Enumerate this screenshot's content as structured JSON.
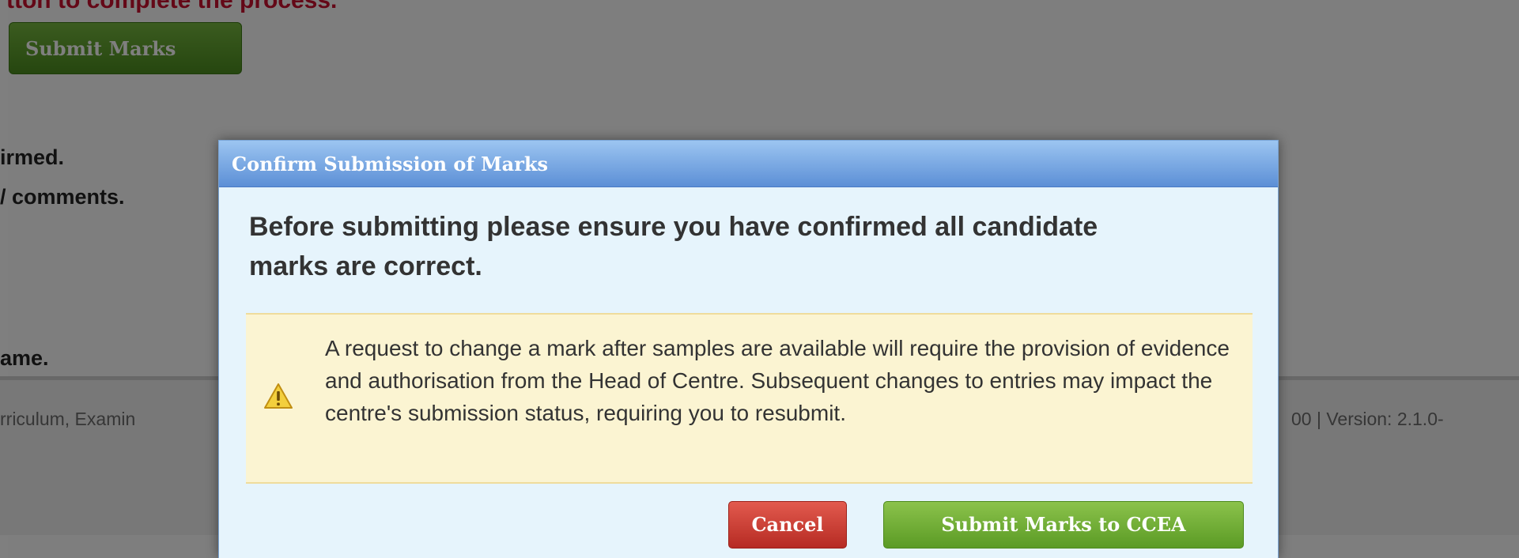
{
  "background": {
    "instruction_text": "tton to complete the process.",
    "submit_button_label": "Submit Marks",
    "text_lines": [
      "irmed.",
      "/ comments.",
      "ame."
    ],
    "footer_left": "rriculum, Examin",
    "footer_right": "00 | Version: 2.1.0-"
  },
  "dialog": {
    "title": "Confirm Submission of Marks",
    "message": "Before submitting please ensure you have confirmed all candidate marks are correct.",
    "warning": {
      "icon": "warning-icon",
      "text": "A request to change a mark after samples are available will require the provision of evidence and authorisation from the Head of Centre. Subsequent changes to entries may impact the centre's submission status, requiring you to resubmit."
    },
    "buttons": {
      "cancel_label": "Cancel",
      "submit_label": "Submit Marks to CCEA"
    }
  },
  "colors": {
    "cancel_button": "#c9362d",
    "submit_button": "#6faa30",
    "titlebar": "#6f9fe0",
    "warning_background": "#fbf4d2",
    "instruction_red": "#c8102e"
  }
}
